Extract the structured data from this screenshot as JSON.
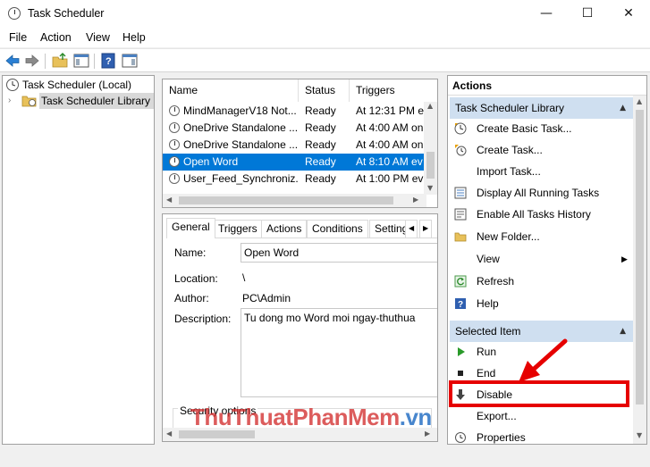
{
  "window": {
    "title": "Task Scheduler",
    "minimize_glyph": "—",
    "maximize_glyph": "☐",
    "close_glyph": "✕"
  },
  "menu": [
    "File",
    "Action",
    "View",
    "Help"
  ],
  "tree": {
    "root": "Task Scheduler (Local)",
    "library": "Task Scheduler Library"
  },
  "task_list": {
    "columns": [
      "Name",
      "Status",
      "Triggers"
    ],
    "rows": [
      {
        "name": "MindManagerV18 Not...",
        "status": "Ready",
        "trigger": "At 12:31 PM ev"
      },
      {
        "name": "OneDrive Standalone ...",
        "status": "Ready",
        "trigger": "At 4:00 AM on"
      },
      {
        "name": "OneDrive Standalone ...",
        "status": "Ready",
        "trigger": "At 4:00 AM on"
      },
      {
        "name": "Open Word",
        "status": "Ready",
        "trigger": "At 8:10 AM ev"
      },
      {
        "name": "User_Feed_Synchroniz...",
        "status": "Ready",
        "trigger": "At 1:00 PM ev"
      }
    ],
    "selected_index": 3
  },
  "detail": {
    "tabs": [
      "General",
      "Triggers",
      "Actions",
      "Conditions",
      "Setting"
    ],
    "active_tab": "General",
    "name_label": "Name:",
    "name_value": "Open Word",
    "location_label": "Location:",
    "location_value": "\\",
    "author_label": "Author:",
    "author_value": "PC\\Admin",
    "description_label": "Description:",
    "description_value": "Tu dong mo Word moi ngay-thuthua",
    "security_label": "Security options"
  },
  "actions": {
    "title": "Actions",
    "section1": "Task Scheduler Library",
    "items1": [
      {
        "label": "Create Basic Task...",
        "icon": "create-basic-task-icon"
      },
      {
        "label": "Create Task...",
        "icon": "create-task-icon"
      },
      {
        "label": "Import Task...",
        "icon": ""
      },
      {
        "label": "Display All Running Tasks",
        "icon": "running-tasks-icon"
      },
      {
        "label": "Enable All Tasks History",
        "icon": "history-icon"
      },
      {
        "label": "New Folder...",
        "icon": "folder-icon"
      },
      {
        "label": "View",
        "icon": ""
      },
      {
        "label": "Refresh",
        "icon": "refresh-icon"
      },
      {
        "label": "Help",
        "icon": "help-icon"
      }
    ],
    "section2": "Selected Item",
    "items2": [
      {
        "label": "Run",
        "icon": "run-icon"
      },
      {
        "label": "End",
        "icon": "end-icon"
      },
      {
        "label": "Disable",
        "icon": "disable-icon"
      },
      {
        "label": "Export...",
        "icon": ""
      },
      {
        "label": "Properties",
        "icon": "properties-icon"
      }
    ]
  },
  "watermark": {
    "part1": "ThuThuat",
    "part2": "PhanMem",
    "part3": ".vn"
  },
  "colors": {
    "selection": "#0078d7",
    "section_bg": "#cfdff0",
    "highlight": "#e60000"
  }
}
